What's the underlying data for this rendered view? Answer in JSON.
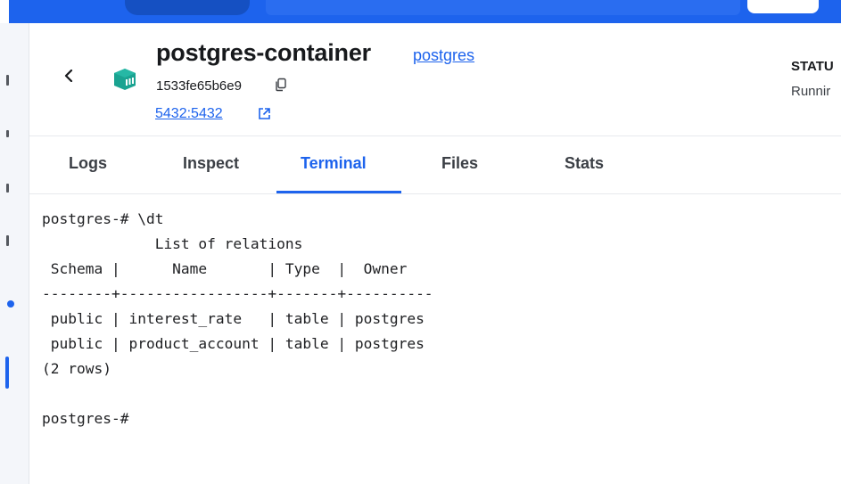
{
  "container": {
    "name": "postgres-container",
    "image": "postgres",
    "id": "1533fe65b6e9",
    "ports": "5432:5432",
    "status_label": "STATU",
    "status_value": "Runnir"
  },
  "tabs": [
    {
      "label": "Logs"
    },
    {
      "label": "Inspect"
    },
    {
      "label": "Terminal"
    },
    {
      "label": "Files"
    },
    {
      "label": "Stats"
    }
  ],
  "active_tab": "Terminal",
  "terminal": {
    "lines": [
      "postgres-# \\dt",
      "             List of relations",
      " Schema |      Name       | Type  |  Owner",
      "--------+-----------------+-------+----------",
      " public | interest_rate   | table | postgres",
      " public | product_account | table | postgres",
      "(2 rows)",
      "",
      "postgres-# "
    ]
  },
  "colors": {
    "accent": "#1d63ed",
    "container_icon": "#1aa391"
  },
  "icons": [
    "back-arrow-icon",
    "container-icon",
    "copy-icon",
    "external-link-icon"
  ]
}
